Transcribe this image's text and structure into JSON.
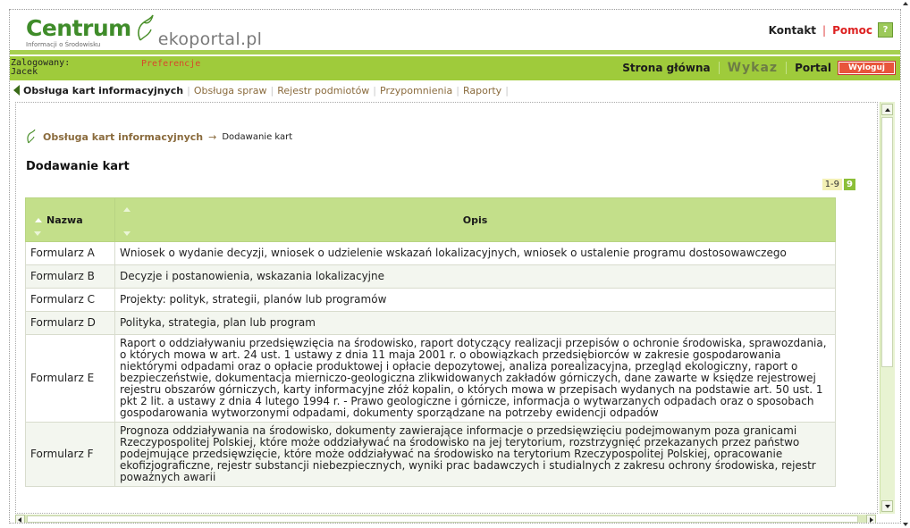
{
  "header": {
    "logo_text": "Centrum",
    "logo_subtitle": "Informacji o Środowisku",
    "portal_name": "ekoportal.pl",
    "links": {
      "kontakt": "Kontakt",
      "pomoc": "Pomoc",
      "help_icon": "?"
    }
  },
  "userbar": {
    "logged_label": "Zalogowany:",
    "user_name": "Jacek",
    "preferences": "Preferencje",
    "nav": {
      "home": "Strona główna",
      "wykaz": "Wykaz",
      "portal": "Portal",
      "logout": "Wyloguj"
    }
  },
  "subnav": {
    "items": [
      "Obsługa kart informacyjnych",
      "Obsługa spraw",
      "Rejestr podmiotów",
      "Przypomnienia",
      "Raporty"
    ],
    "active_index": 0
  },
  "breadcrumb": {
    "parent": "Obsługa kart informacyjnych",
    "current": "Dodawanie kart"
  },
  "page_title": "Dodawanie kart",
  "pager": {
    "range": "1-9",
    "count": "9"
  },
  "table": {
    "columns": [
      "Nazwa",
      "Opis"
    ],
    "rows": [
      {
        "name": "Formularz A",
        "desc": "Wniosek o wydanie decyzji, wniosek o udzielenie wskazań lokalizacyjnych, wniosek o ustalenie programu dostosowawczego"
      },
      {
        "name": "Formularz B",
        "desc": "Decyzje i postanowienia, wskazania lokalizacyjne"
      },
      {
        "name": "Formularz C",
        "desc": "Projekty: polityk, strategii, planów lub programów"
      },
      {
        "name": "Formularz D",
        "desc": "Polityka, strategia, plan lub program"
      },
      {
        "name": "Formularz E",
        "desc": "Raport o oddziaływaniu przedsięwzięcia na środowisko, raport dotyczący realizacji przepisów o ochronie środowiska, sprawozdania, o których mowa w art. 24 ust. 1 ustawy z dnia 11 maja 2001 r. o obowiązkach przedsiębiorców w zakresie gospodarowania niektórymi odpadami oraz o opłacie produktowej i opłacie depozytowej, analiza porealizacyjna, przegląd ekologiczny, raport o bezpieczeństwie, dokumentacja mierniczo-geologiczna zlikwidowanych zakładów górniczych, dane zawarte w księdze rejestrowej rejestru obszarów górniczych, karty informacyjne złóż kopalin, o których mowa w przepisach wydanych na podstawie art. 50 ust. 1 pkt 2 lit. a ustawy z dnia 4 lutego 1994 r. - Prawo geologiczne i górnicze, informacja o wytwarzanych odpadach oraz o sposobach gospodarowania wytworzonymi odpadami, dokumenty sporządzane na potrzeby ewidencji odpadów"
      },
      {
        "name": "Formularz F",
        "desc": "Prognoza oddziaływania na środowisko, dokumenty zawierające informacje o przedsięwzięciu podejmowanym poza granicami Rzeczypospolitej Polskiej, które może oddziaływać na środowisko na jej terytorium, rozstrzygnięć przekazanych przez państwo podejmujące przedsięwzięcie, które może oddziaływać na środowisko na terytorium Rzeczypospolitej Polskiej, opracowanie ekofizjograficzne, rejestr substancji niebezpiecznych, wyniki prac badawczych i studialnych z zakresu ochrony środowiska, rejestr poważnych awarii"
      }
    ]
  },
  "colors": {
    "accent_green": "#9fcb3b",
    "logo_green": "#3f8c2a",
    "link_brown": "#8a6b3d",
    "logout_red": "#e8553b",
    "header_row": "#c3df8a"
  }
}
